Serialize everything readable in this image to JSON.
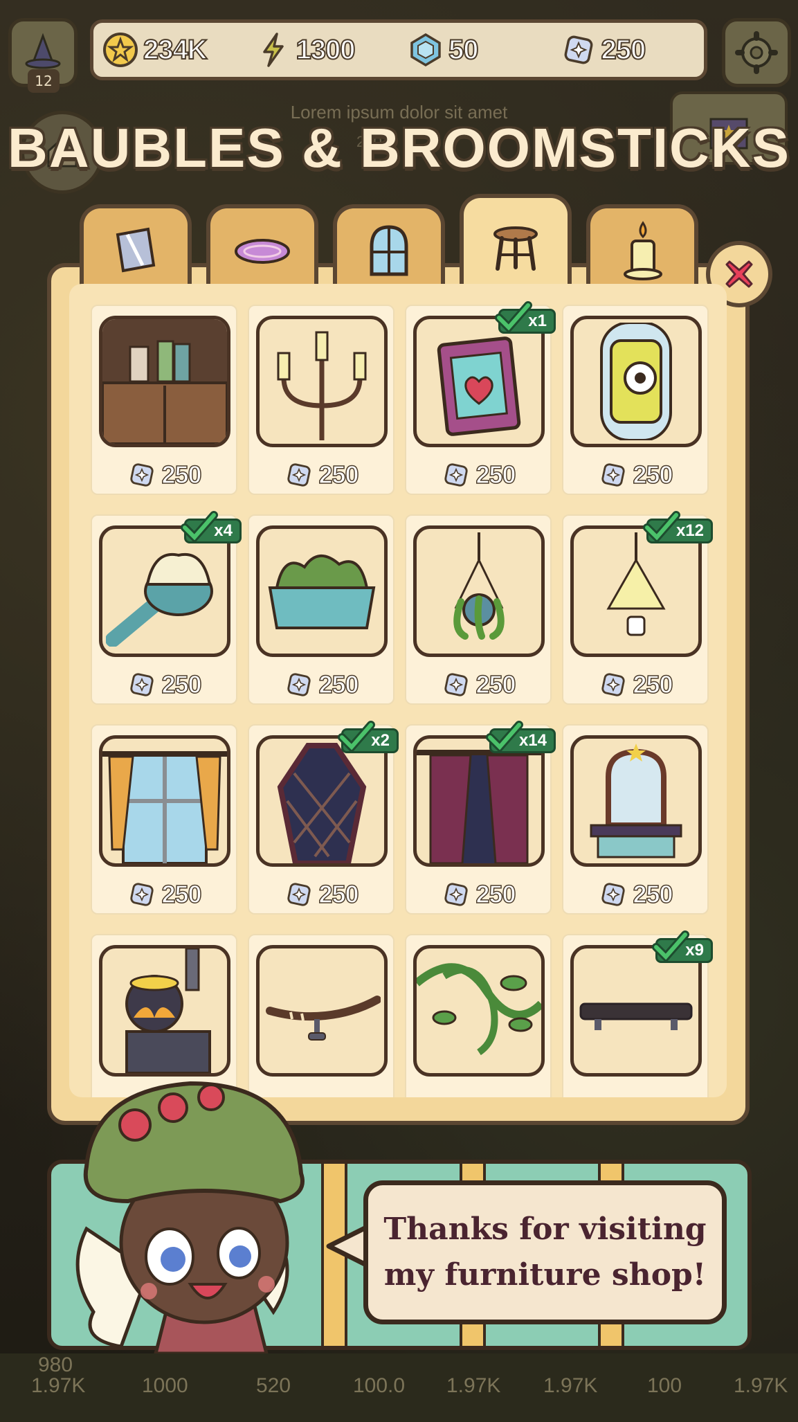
{
  "currencies": [
    {
      "icon": "star-coin-icon",
      "value": "234K"
    },
    {
      "icon": "lightning-icon",
      "value": "1300"
    },
    {
      "icon": "blue-gem-icon",
      "value": "50"
    },
    {
      "icon": "sparkle-gem-icon",
      "value": "250"
    }
  ],
  "player_level": "12",
  "subtitle": "Lorem ipsum dolor sit amet",
  "background_counter": "260",
  "shop_title": "BAUBLES & BROOMSTICKS",
  "tabs": [
    {
      "icon": "wallpaper-icon",
      "active": false
    },
    {
      "icon": "rug-icon",
      "active": false
    },
    {
      "icon": "window-icon",
      "active": false
    },
    {
      "icon": "stool-icon",
      "active": true
    },
    {
      "icon": "candle-icon",
      "active": false
    }
  ],
  "items": [
    {
      "name": "cabinet",
      "price": "250",
      "owned": ""
    },
    {
      "name": "candelabra",
      "price": "250",
      "owned": ""
    },
    {
      "name": "heart-frame",
      "price": "250",
      "owned": "x1"
    },
    {
      "name": "eye-lamp",
      "price": "250",
      "owned": ""
    },
    {
      "name": "brush",
      "price": "250",
      "owned": "x4"
    },
    {
      "name": "planter",
      "price": "250",
      "owned": ""
    },
    {
      "name": "hanging-plant",
      "price": "250",
      "owned": ""
    },
    {
      "name": "lantern",
      "price": "250",
      "owned": "x12"
    },
    {
      "name": "curtained-window",
      "price": "250",
      "owned": ""
    },
    {
      "name": "coffin-window",
      "price": "250",
      "owned": "x2"
    },
    {
      "name": "dark-curtains",
      "price": "250",
      "owned": "x14"
    },
    {
      "name": "vanity-mirror",
      "price": "250",
      "owned": ""
    },
    {
      "name": "cauldron-stove",
      "price": "",
      "owned": ""
    },
    {
      "name": "branch-shelf",
      "price": "",
      "owned": ""
    },
    {
      "name": "vine",
      "price": "",
      "owned": ""
    },
    {
      "name": "wall-shelf",
      "price": "",
      "owned": "x9"
    }
  ],
  "dialog_text": "Thanks for visiting\nmy furniture shop!",
  "bottom_stats": [
    "980",
    "1.97K",
    "1000",
    "520",
    "100.0",
    "1.97K",
    "1.97K",
    "100",
    "1.97K"
  ],
  "colors": {
    "owned_badge": "#2f7a4a",
    "panel": "#f3d79b",
    "outline": "#5a4632",
    "close": "#e8405a"
  }
}
